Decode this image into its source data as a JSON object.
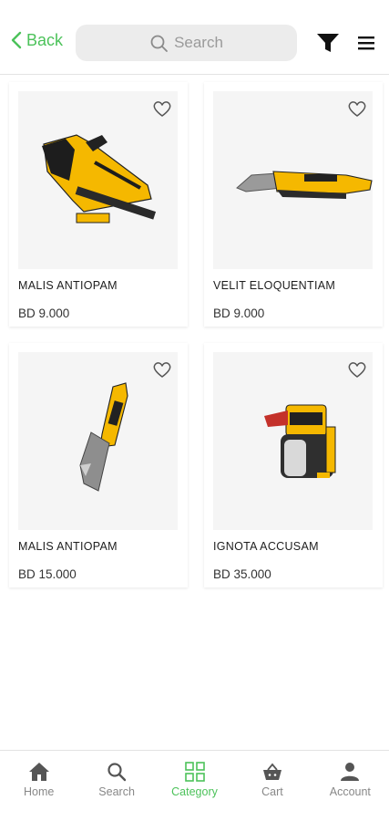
{
  "header": {
    "back_label": "Back",
    "search_placeholder": "Search"
  },
  "products": [
    {
      "name": "MALIS ANTIOPAM",
      "price": "BD 9.000",
      "image": "stapler-tacker-tool",
      "favorite": false
    },
    {
      "name": "VELIT ELOQUENTIAM",
      "price": "BD 9.000",
      "image": "utility-knife",
      "favorite": false
    },
    {
      "name": "MALIS ANTIOPAM",
      "price": "BD 15.000",
      "image": "folding-utility-knife",
      "favorite": false
    },
    {
      "name": "IGNOTA ACCUSAM",
      "price": "BD 35.000",
      "image": "paint-sprayer",
      "favorite": false
    }
  ],
  "bottom_nav": [
    {
      "label": "Home",
      "icon": "home-icon",
      "active": false
    },
    {
      "label": "Search",
      "icon": "search-icon",
      "active": false
    },
    {
      "label": "Category",
      "icon": "category-icon",
      "active": true
    },
    {
      "label": "Cart",
      "icon": "cart-icon",
      "active": false
    },
    {
      "label": "Account",
      "icon": "account-icon",
      "active": false
    }
  ],
  "colors": {
    "accent": "#4cc25a",
    "product_yellow": "#f5b800",
    "inactive": "#888888"
  }
}
